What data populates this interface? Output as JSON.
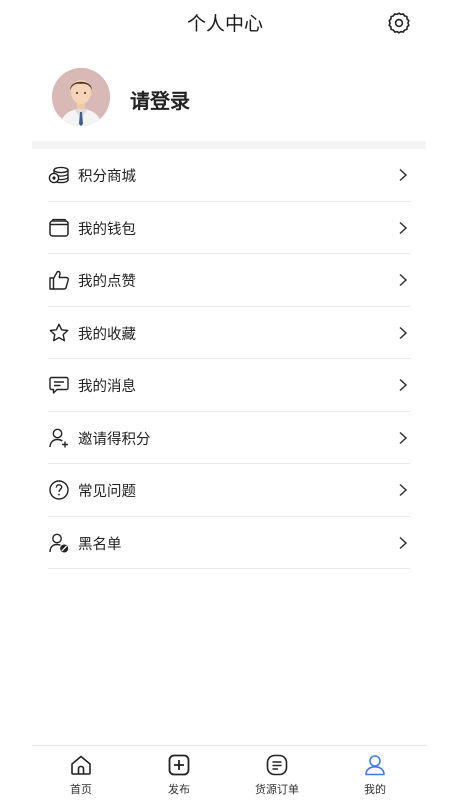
{
  "header": {
    "title": "个人中心"
  },
  "profile": {
    "login_text": "请登录"
  },
  "menu": [
    {
      "label": "积分商城",
      "icon": "points-mall-icon"
    },
    {
      "label": "我的钱包",
      "icon": "wallet-icon"
    },
    {
      "label": "我的点赞",
      "icon": "thumbs-up-icon"
    },
    {
      "label": "我的收藏",
      "icon": "star-icon"
    },
    {
      "label": "我的消息",
      "icon": "message-icon"
    },
    {
      "label": "邀请得积分",
      "icon": "invite-user-icon"
    },
    {
      "label": "常见问题",
      "icon": "question-icon"
    },
    {
      "label": "黑名单",
      "icon": "blacklist-user-icon"
    }
  ],
  "tabbar": [
    {
      "label": "首页",
      "icon": "home-icon"
    },
    {
      "label": "发布",
      "icon": "plus-square-icon"
    },
    {
      "label": "货源订单",
      "icon": "order-list-icon"
    },
    {
      "label": "我的",
      "icon": "user-icon",
      "active": true
    }
  ],
  "colors": {
    "accent": "#3d7be0",
    "text": "#222222",
    "divider": "#e9e9e9"
  }
}
